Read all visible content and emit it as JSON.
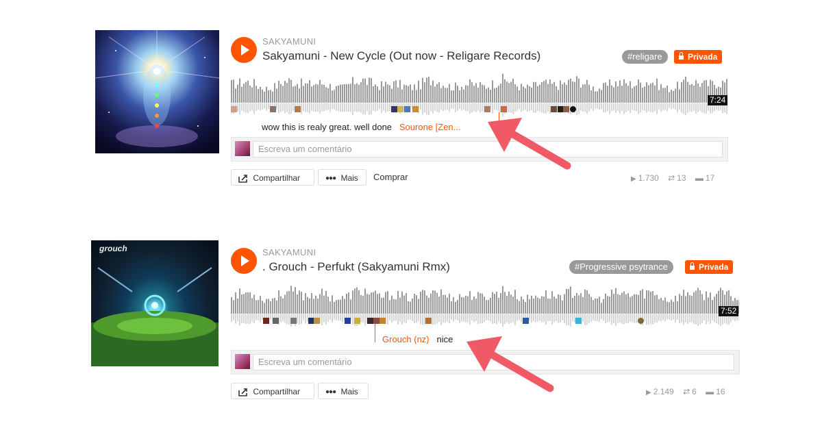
{
  "tracks": [
    {
      "user": "SAKYAMUNI",
      "title": "Sakyamuni - New Cycle (Out now - Religare Records)",
      "tag": "#religare",
      "private_label": "Privada",
      "duration": "7:24",
      "comment": {
        "user": "Sourone [Zen...",
        "text": "wow this is realy great. well done"
      },
      "comment_placeholder": "Escreva um comentário",
      "buttons": {
        "share": "Compartilhar",
        "more": "Mais",
        "buy": "Comprar"
      },
      "stats": {
        "plays": "1.730",
        "reposts": "13",
        "comments": "17"
      },
      "icons": {
        "play": "play-icon",
        "lock": "lock-icon",
        "share": "share-icon",
        "more": "more-dots-icon",
        "plays": "play-count-icon",
        "reposts": "repost-icon",
        "comments": "comment-icon"
      }
    },
    {
      "user": "SAKYAMUNI",
      "title": ". Grouch - Perfukt (Sakyamuni Rmx)",
      "tag": "#Progressive psytrance",
      "private_label": "Privada",
      "duration": "7:52",
      "comment": {
        "user": "Grouch (nz)",
        "text": "nice"
      },
      "comment_placeholder": "Escreva um comentário",
      "buttons": {
        "share": "Compartilhar",
        "more": "Mais"
      },
      "stats": {
        "plays": "2.149",
        "reposts": "6",
        "comments": "16"
      },
      "artwork_text": "grouch"
    }
  ],
  "colors": {
    "accent": "#ff5500",
    "waveform": "#999999",
    "tag": "#999999",
    "annotation_arrow": "#f05a66"
  }
}
